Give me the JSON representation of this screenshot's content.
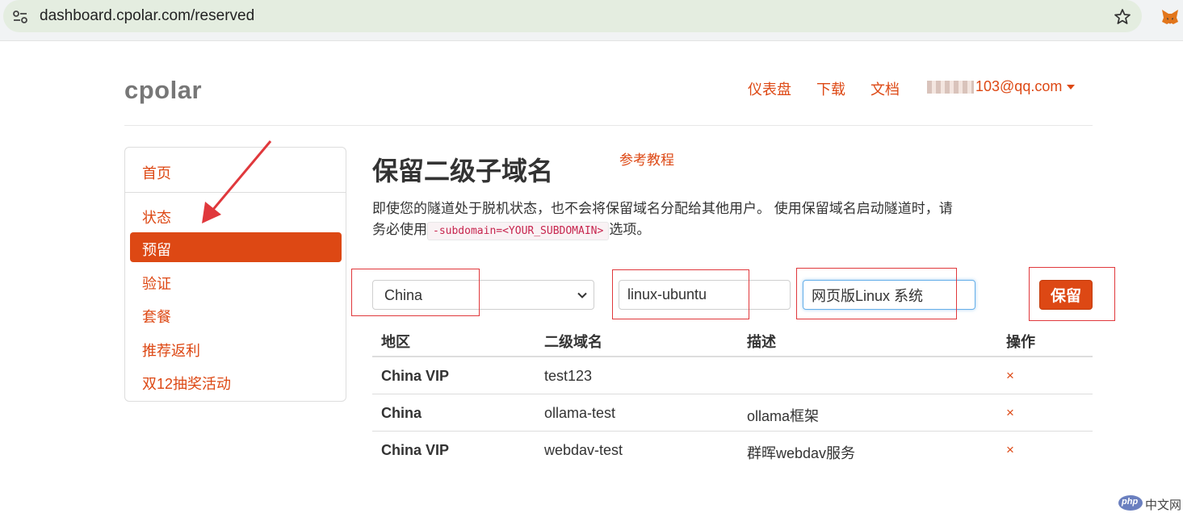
{
  "browser": {
    "url": "dashboard.cpolar.com/reserved"
  },
  "header": {
    "brand": "cpolar",
    "nav": [
      "仪表盘",
      "下载",
      "文档"
    ],
    "user_email_suffix": "103@qq.com"
  },
  "sidebar": {
    "items": [
      {
        "label": "首页",
        "active": false
      },
      {
        "label": "状态",
        "active": false
      },
      {
        "label": "预留",
        "active": true
      },
      {
        "label": "验证",
        "active": false
      },
      {
        "label": "套餐",
        "active": false
      },
      {
        "label": "推荐返利",
        "active": false
      },
      {
        "label": "双12抽奖活动",
        "active": false
      }
    ]
  },
  "main": {
    "title": "保留二级子域名",
    "ref_link": "参考教程",
    "desc_part1": "即使您的隧道处于脱机状态，也不会将保留域名分配给其他用户。 使用保留域名启动隧道时，请务必使用",
    "desc_code": "-subdomain=<YOUR_SUBDOMAIN>",
    "desc_part2": "选项。"
  },
  "form": {
    "region_value": "China",
    "subdomain_value": "linux-ubuntu",
    "description_value": "网页版Linux 系统",
    "save_label": "保留"
  },
  "table": {
    "headers": [
      "地区",
      "二级域名",
      "描述",
      "操作"
    ],
    "rows": [
      {
        "region": "China VIP",
        "subdomain": "test123",
        "description": "",
        "action": "×"
      },
      {
        "region": "China",
        "subdomain": "ollama-test",
        "description": "ollama框架",
        "action": "×"
      },
      {
        "region": "China VIP",
        "subdomain": "webdav-test",
        "description": "群晖webdav服务",
        "action": "×"
      }
    ]
  },
  "watermark": {
    "logo_text": "php",
    "site_text": "中文网"
  },
  "colors": {
    "accent": "#dd4814",
    "annotation": "#e0383c"
  }
}
